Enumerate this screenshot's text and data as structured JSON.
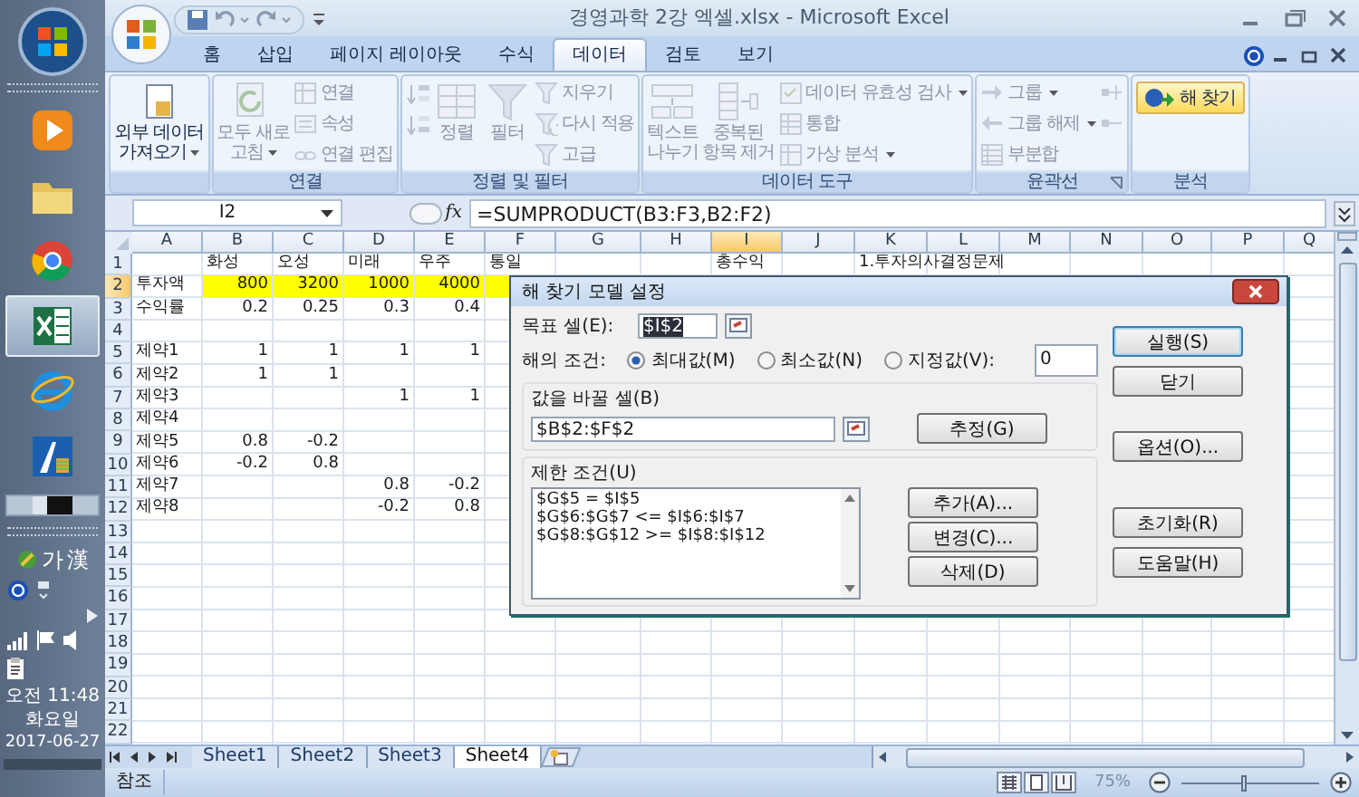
{
  "taskbar": {
    "apps": [
      {
        "kind": "media",
        "selected": false
      },
      {
        "kind": "folder",
        "selected": false
      },
      {
        "kind": "chrome",
        "selected": false
      },
      {
        "kind": "sheet",
        "selected": true
      },
      {
        "kind": "globe",
        "selected": false
      },
      {
        "kind": "app",
        "selected": false
      }
    ],
    "ime": [
      "가",
      "漢"
    ],
    "clock": {
      "time": "오전 11:48",
      "day": "화요일",
      "date": "2017-06-27"
    }
  },
  "window": {
    "title": "경영과학 2강 엑셀.xlsx - Microsoft Excel"
  },
  "tabs": [
    {
      "label": "홈",
      "selected": false
    },
    {
      "label": "삽입",
      "selected": false
    },
    {
      "label": "페이지 레이아웃",
      "selected": false
    },
    {
      "label": "수식",
      "selected": false
    },
    {
      "label": "데이터",
      "selected": true
    },
    {
      "label": "검토",
      "selected": false
    },
    {
      "label": "보기",
      "selected": false
    }
  ],
  "ribbon": [
    {
      "launcher": false,
      "items": [
        {
          "kind": "large",
          "label": "외부 데이터\n가져오기",
          "dropdown": true,
          "disabled": false
        }
      ]
    },
    {
      "label": "연결",
      "launcher": false,
      "items": [
        {
          "kind": "large",
          "label": "모두 새로\n고침",
          "dropdown": true,
          "disabled": true
        },
        {
          "kind": "small",
          "label": "연결",
          "dropdown": false,
          "disabled": true
        },
        {
          "kind": "small",
          "label": "속성",
          "dropdown": false,
          "disabled": true
        },
        {
          "kind": "small",
          "label": "연결 편집",
          "dropdown": false,
          "disabled": true
        }
      ]
    },
    {
      "label": "정렬 및 필터",
      "launcher": false,
      "items": [
        {
          "kind": "icon",
          "dropdown": false,
          "disabled": true
        },
        {
          "kind": "icon",
          "dropdown": false,
          "disabled": true
        },
        {
          "kind": "large",
          "label": "정렬",
          "dropdown": false,
          "disabled": true
        },
        {
          "kind": "large",
          "label": "필터",
          "dropdown": false,
          "disabled": true
        },
        {
          "kind": "small",
          "label": "지우기",
          "dropdown": false,
          "disabled": true
        },
        {
          "kind": "small",
          "label": "다시 적용",
          "dropdown": false,
          "disabled": true
        },
        {
          "kind": "small",
          "label": "고급",
          "dropdown": false,
          "disabled": true
        }
      ]
    },
    {
      "label": "데이터 도구",
      "launcher": false,
      "items": [
        {
          "kind": "large",
          "label": "텍스트\n나누기",
          "dropdown": false,
          "disabled": true
        },
        {
          "kind": "large",
          "label": "중복된\n항목 제거",
          "dropdown": false,
          "disabled": true
        },
        {
          "kind": "small",
          "label": "데이터 유효성 검사",
          "dropdown": true,
          "disabled": true
        },
        {
          "kind": "small",
          "label": "통합",
          "dropdown": false,
          "disabled": true
        },
        {
          "kind": "small",
          "label": "가상 분석",
          "dropdown": true,
          "disabled": true
        }
      ]
    },
    {
      "label": "윤곽선",
      "launcher": true,
      "items": [
        {
          "kind": "small",
          "label": "그룹",
          "dropdown": true,
          "disabled": true
        },
        {
          "kind": "small",
          "label": "그룹 해제",
          "dropdown": true,
          "disabled": true
        },
        {
          "kind": "small",
          "label": "부분합",
          "dropdown": false,
          "disabled": true
        },
        {
          "kind": "icon",
          "dropdown": false,
          "disabled": true
        },
        {
          "kind": "icon",
          "dropdown": false,
          "disabled": true
        }
      ]
    },
    {
      "label": "분석",
      "launcher": false,
      "items": [
        {
          "kind": "highlight",
          "label": "해 찾기",
          "dropdown": false,
          "disabled": false
        }
      ]
    }
  ],
  "formula_bar": {
    "name_box": "I2",
    "function_button": "fx",
    "formula": "=SUMPRODUCT(B3:F3,B2:F2)"
  },
  "sheet": {
    "columns": [
      {
        "label": "A",
        "selected": false
      },
      {
        "label": "B",
        "selected": false
      },
      {
        "label": "C",
        "selected": false
      },
      {
        "label": "D",
        "selected": false
      },
      {
        "label": "E",
        "selected": false
      },
      {
        "label": "F",
        "selected": false
      },
      {
        "label": "G",
        "selected": false
      },
      {
        "label": "H",
        "selected": false
      },
      {
        "label": "I",
        "selected": true
      },
      {
        "label": "J",
        "selected": false
      },
      {
        "label": "K",
        "selected": false
      },
      {
        "label": "L",
        "selected": false
      },
      {
        "label": "M",
        "selected": false
      },
      {
        "label": "N",
        "selected": false
      },
      {
        "label": "O",
        "selected": false
      },
      {
        "label": "P",
        "selected": false
      },
      {
        "label": "Q",
        "selected": false
      }
    ],
    "rows": [
      {
        "label": "1",
        "selected": false,
        "cells": [
          "",
          "화성",
          "오성",
          "미래",
          "우주",
          "통일",
          "",
          "",
          "총수익",
          "",
          "1.투자의사결정문제"
        ]
      },
      {
        "label": "2",
        "selected": true,
        "cells": [
          "투자액",
          {
            "kind": "number",
            "text": "800",
            "color": "#ffff00"
          },
          {
            "kind": "number",
            "text": "3200",
            "color": "#ffff00"
          },
          {
            "kind": "number",
            "text": "1000",
            "color": "#ffff00"
          },
          {
            "kind": "number",
            "text": "4000",
            "color": "#ffff00"
          },
          {
            "color": "#ffff00"
          }
        ]
      },
      {
        "label": "3",
        "selected": false,
        "cells": [
          "수익률",
          {
            "kind": "number",
            "text": "0.2"
          },
          {
            "kind": "number",
            "text": "0.25"
          },
          {
            "kind": "number",
            "text": "0.3"
          },
          {
            "kind": "number",
            "text": "0.4"
          }
        ]
      },
      {
        "label": "4",
        "selected": false,
        "cells": []
      },
      {
        "label": "5",
        "selected": false,
        "cells": [
          "제약1",
          {
            "kind": "number",
            "text": "1"
          },
          {
            "kind": "number",
            "text": "1"
          },
          {
            "kind": "number",
            "text": "1"
          },
          {
            "kind": "number",
            "text": "1"
          }
        ]
      },
      {
        "label": "6",
        "selected": false,
        "cells": [
          "제약2",
          {
            "kind": "number",
            "text": "1"
          },
          {
            "kind": "number",
            "text": "1"
          }
        ]
      },
      {
        "label": "7",
        "selected": false,
        "cells": [
          "제약3",
          "",
          "",
          {
            "kind": "number",
            "text": "1"
          },
          {
            "kind": "number",
            "text": "1"
          }
        ]
      },
      {
        "label": "8",
        "selected": false,
        "cells": [
          "제약4"
        ]
      },
      {
        "label": "9",
        "selected": false,
        "cells": [
          "제약5",
          {
            "kind": "number",
            "text": "0.8"
          },
          {
            "kind": "number",
            "text": "-0.2"
          }
        ]
      },
      {
        "label": "10",
        "selected": false,
        "cells": [
          "제약6",
          {
            "kind": "number",
            "text": "-0.2"
          },
          {
            "kind": "number",
            "text": "0.8"
          }
        ]
      },
      {
        "label": "11",
        "selected": false,
        "cells": [
          "제약7",
          "",
          "",
          {
            "kind": "number",
            "text": "0.8"
          },
          {
            "kind": "number",
            "text": "-0.2"
          }
        ]
      },
      {
        "label": "12",
        "selected": false,
        "cells": [
          "제약8",
          "",
          "",
          {
            "kind": "number",
            "text": "-0.2"
          },
          {
            "kind": "number",
            "text": "0.8"
          }
        ]
      },
      {
        "label": "13",
        "selected": false,
        "cells": []
      },
      {
        "label": "14",
        "selected": false,
        "cells": []
      },
      {
        "label": "15",
        "selected": false,
        "cells": []
      },
      {
        "label": "16",
        "selected": false,
        "cells": []
      },
      {
        "label": "17",
        "selected": false,
        "cells": []
      },
      {
        "label": "18",
        "selected": false,
        "cells": []
      },
      {
        "label": "19",
        "selected": false,
        "cells": []
      },
      {
        "label": "20",
        "selected": false,
        "cells": []
      },
      {
        "label": "21",
        "selected": false,
        "cells": []
      },
      {
        "label": "22",
        "selected": false,
        "cells": []
      }
    ]
  },
  "sheet_tabs": [
    {
      "label": "Sheet1",
      "selected": false
    },
    {
      "label": "Sheet2",
      "selected": false
    },
    {
      "label": "Sheet3",
      "selected": false
    },
    {
      "label": "Sheet4",
      "selected": true
    }
  ],
  "status_bar": {
    "mode": "참조",
    "zoom": "75%",
    "zoom_slider": {
      "level": 0.45
    }
  },
  "dialog": {
    "title": "해 찾기 모델 설정",
    "target": {
      "label": "목표 셀(E):",
      "value": "$I$2"
    },
    "goal": {
      "label": "해의 조건:",
      "options": [
        {
          "label": "최대값(M)",
          "selected": true
        },
        {
          "label": "최소값(N)",
          "selected": false
        },
        {
          "label": "지정값(V):",
          "selected": false
        }
      ],
      "value": "0"
    },
    "changing": {
      "label": "값을 바꿀 셀(B)",
      "value": "$B$2:$F$2",
      "button": "추정(G)"
    },
    "constraints": {
      "label": "제한 조건(U)",
      "items": [
        "$G$5 = $I$5",
        "$G$6:$G$7 <= $I$6:$I$7",
        "$G$8:$G$12 >= $I$8:$I$12"
      ],
      "buttons": [
        "추가(A)...",
        "변경(C)...",
        "삭제(D)"
      ]
    },
    "side_buttons": [
      "실행(S)",
      "닫기",
      "옵션(O)...",
      "초기화(R)",
      "도움말(H)"
    ]
  }
}
